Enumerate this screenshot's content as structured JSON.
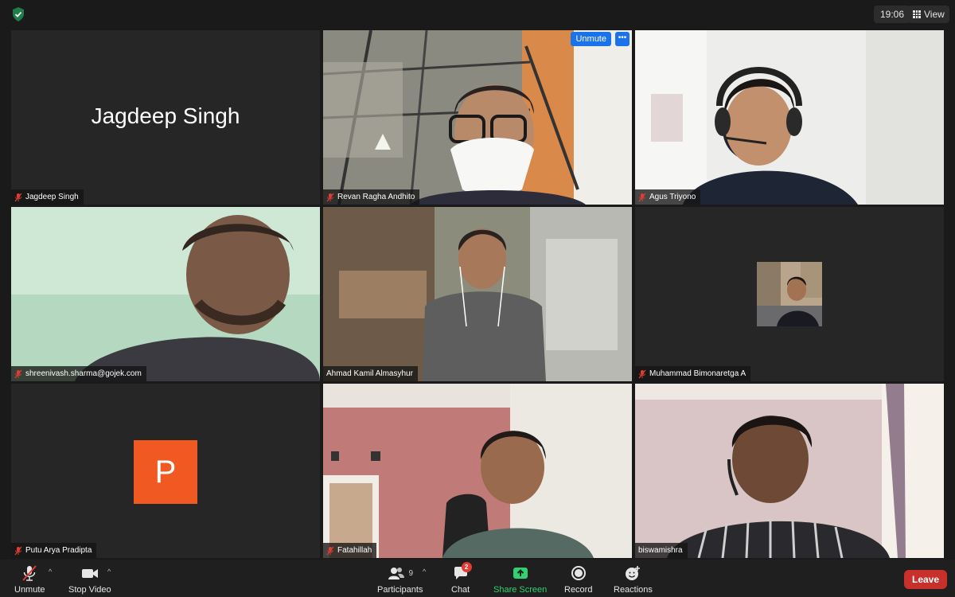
{
  "topbar": {
    "time": "19:06",
    "view_label": "View"
  },
  "tiles": [
    {
      "name": "Jagdeep Singh",
      "display_name": "Jagdeep Singh",
      "muted": true
    },
    {
      "name": "Revan Ragha Andhito",
      "muted": true,
      "unmute_label": "Unmute",
      "more_label": "•••"
    },
    {
      "name": "Agus Triyono",
      "muted": true
    },
    {
      "name": "shreenivash.sharma@gojek.com",
      "muted": true
    },
    {
      "name": "Ahmad Kamil Almasyhur",
      "muted": false,
      "active_speaker": true
    },
    {
      "name": "Muhammad Bimonaretga A",
      "muted": true
    },
    {
      "name": "Putu Arya Pradipta",
      "initial": "P",
      "muted": true
    },
    {
      "name": "Fatahillah",
      "muted": true
    },
    {
      "name": "biswamishra",
      "muted": false
    }
  ],
  "toolbar": {
    "unmute": "Unmute",
    "stop_video": "Stop Video",
    "participants": "Participants",
    "participants_count": "9",
    "chat": "Chat",
    "chat_badge": "2",
    "share_screen": "Share Screen",
    "record": "Record",
    "reactions": "Reactions",
    "leave": "Leave"
  },
  "colors": {
    "leave": "#c8302c",
    "share": "#2fd170",
    "active_outline": "#d8e784",
    "unmute_btn": "#1a73e8",
    "avatar_initial_bg": "#f05a22"
  }
}
